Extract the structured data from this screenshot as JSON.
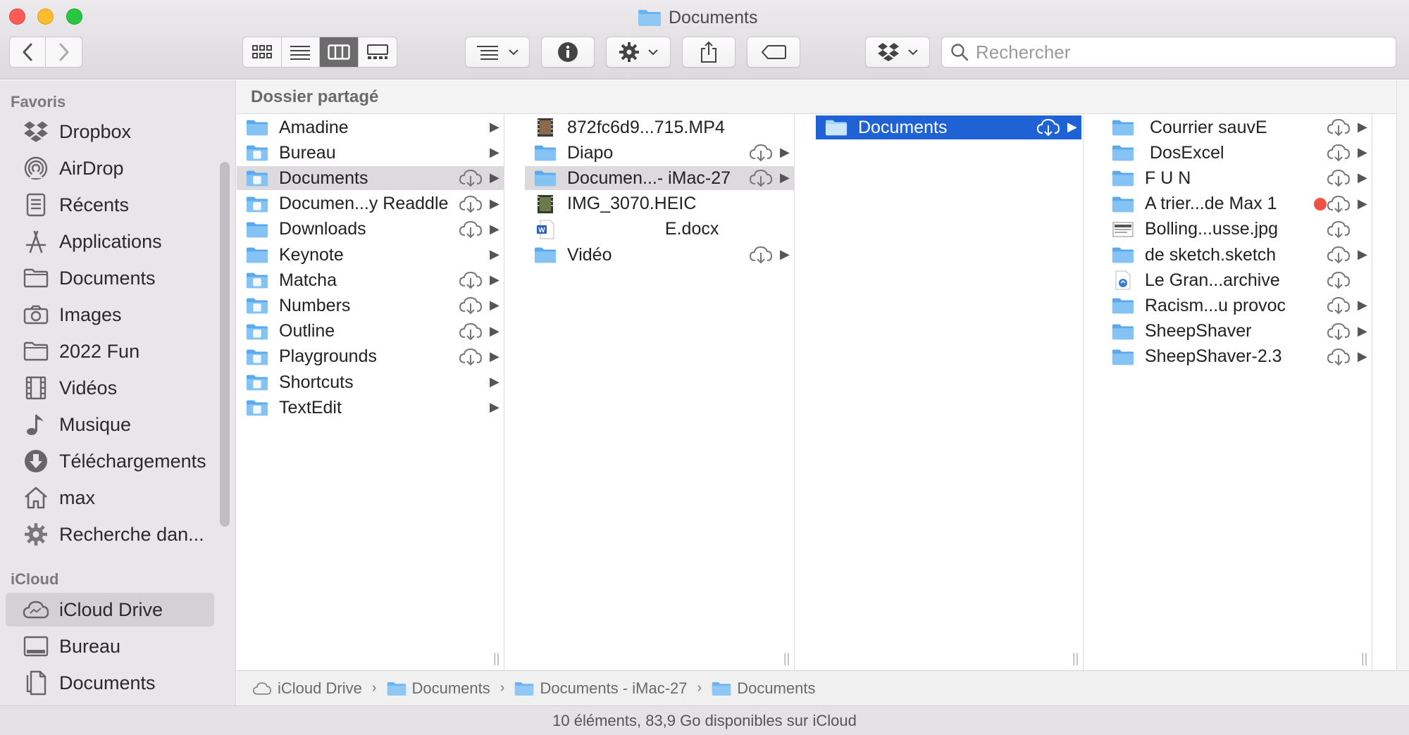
{
  "window": {
    "title": "Documents"
  },
  "toolbar": {
    "search_placeholder": "Rechercher"
  },
  "sidebar": {
    "favorites_heading": "Favoris",
    "favorites": [
      {
        "label": "Dropbox",
        "icon": "dropbox-icon"
      },
      {
        "label": "AirDrop",
        "icon": "airdrop-icon"
      },
      {
        "label": "Récents",
        "icon": "recents-icon"
      },
      {
        "label": "Applications",
        "icon": "applications-icon"
      },
      {
        "label": "Documents",
        "icon": "folder-icon"
      },
      {
        "label": "Images",
        "icon": "camera-icon"
      },
      {
        "label": "2022 Fun",
        "icon": "folder-icon"
      },
      {
        "label": "Vidéos",
        "icon": "film-icon"
      },
      {
        "label": "Musique",
        "icon": "music-icon"
      },
      {
        "label": "Téléchargements",
        "icon": "download-icon"
      },
      {
        "label": "max",
        "icon": "home-icon"
      },
      {
        "label": "Recherche dan...",
        "icon": "gear-icon"
      }
    ],
    "icloud_heading": "iCloud",
    "icloud": [
      {
        "label": "iCloud Drive",
        "icon": "icloud-icon",
        "selected": true
      },
      {
        "label": "Bureau",
        "icon": "desktop-icon"
      },
      {
        "label": "Documents",
        "icon": "document-icon"
      }
    ]
  },
  "path_header": "Dossier partagé",
  "columns": [
    {
      "items": [
        {
          "label": "Amadine",
          "cloud": false,
          "chevron": true
        },
        {
          "label": "Bureau",
          "cloud": false,
          "chevron": true
        },
        {
          "label": "Documents",
          "cloud": true,
          "chevron": true,
          "selected": "gray"
        },
        {
          "label": "Documen...y Readdle",
          "cloud": true,
          "chevron": true
        },
        {
          "label": "Downloads",
          "cloud": true,
          "chevron": true
        },
        {
          "label": "Keynote",
          "cloud": false,
          "chevron": true
        },
        {
          "label": "Matcha",
          "cloud": true,
          "chevron": true
        },
        {
          "label": "Numbers",
          "cloud": true,
          "chevron": true
        },
        {
          "label": "Outline",
          "cloud": true,
          "chevron": true
        },
        {
          "label": "Playgrounds",
          "cloud": true,
          "chevron": true
        },
        {
          "label": "Shortcuts",
          "cloud": false,
          "chevron": true
        },
        {
          "label": "TextEdit",
          "cloud": false,
          "chevron": true
        }
      ]
    },
    {
      "items": [
        {
          "label": "872fc6d9...715.MP4",
          "cloud": false,
          "chevron": false,
          "kind": "video"
        },
        {
          "label": "Diapo",
          "cloud": true,
          "chevron": true
        },
        {
          "label": "Documen...- iMac-27",
          "cloud": true,
          "chevron": true,
          "selected": "gray"
        },
        {
          "label": "IMG_3070.HEIC",
          "cloud": false,
          "chevron": false,
          "kind": "image"
        },
        {
          "label": "                    E.docx",
          "cloud": false,
          "chevron": false,
          "kind": "word"
        },
        {
          "label": "Vidéo",
          "cloud": true,
          "chevron": true
        }
      ]
    },
    {
      "items": [
        {
          "label": "Documents",
          "cloud": true,
          "chevron": true,
          "selected": "blue"
        }
      ]
    },
    {
      "items": [
        {
          "label": " Courrier sauvE",
          "cloud": true,
          "chevron": true
        },
        {
          "label": " DosExcel",
          "cloud": true,
          "chevron": true
        },
        {
          "label": "F U N",
          "cloud": true,
          "chevron": true
        },
        {
          "label": "A trier...de Max 1",
          "cloud": true,
          "chevron": true,
          "tag": "#ee5345"
        },
        {
          "label": "Bolling...usse.jpg",
          "cloud": true,
          "chevron": false,
          "kind": "jpg"
        },
        {
          "label": "de sketch.sketch",
          "cloud": true,
          "chevron": true
        },
        {
          "label": "Le Gran...archive",
          "cloud": true,
          "chevron": false,
          "kind": "archive"
        },
        {
          "label": "Racism...u provoc",
          "cloud": true,
          "chevron": true
        },
        {
          "label": "SheepShaver",
          "cloud": true,
          "chevron": true
        },
        {
          "label": "SheepShaver-2.3",
          "cloud": true,
          "chevron": true
        }
      ]
    }
  ],
  "breadcrumb": [
    {
      "label": "iCloud Drive",
      "icon": "icloud-icon"
    },
    {
      "label": "Documents",
      "icon": "folder-icon"
    },
    {
      "label": "Documents - iMac-27",
      "icon": "folder-icon"
    },
    {
      "label": "Documents",
      "icon": "folder-icon"
    }
  ],
  "status": "10 éléments, 83,9 Go disponibles sur iCloud",
  "colors": {
    "selection_blue": "#1e62d6",
    "folder_blue": "#6cb4ef",
    "tag_red": "#ee5345"
  }
}
